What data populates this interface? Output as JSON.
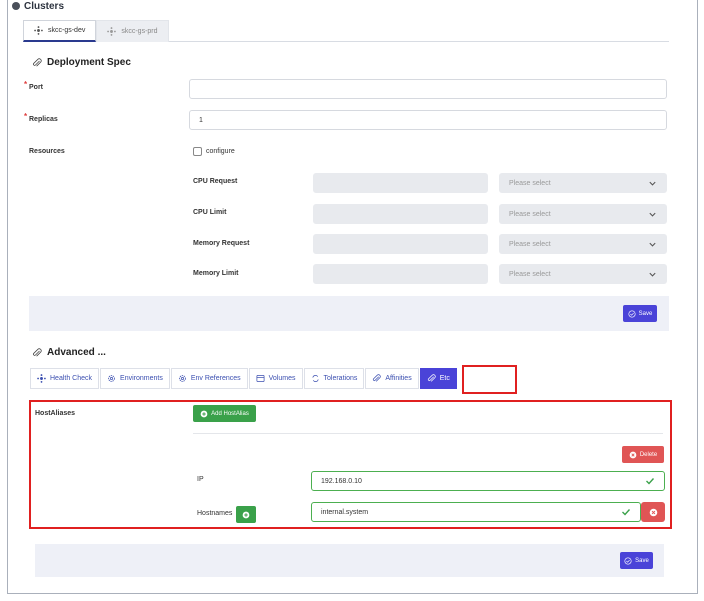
{
  "clusters": {
    "title": "Clusters",
    "tabs": [
      {
        "label": "skcc-gs-dev"
      },
      {
        "label": "skcc-gs-prd"
      }
    ]
  },
  "deployment_spec": {
    "title": "Deployment Spec",
    "port_label": "Port",
    "port_value": "",
    "replicas_label": "Replicas",
    "replicas_value": "1",
    "resources_label": "Resources",
    "configure_label": "configure",
    "rows": [
      {
        "label": "CPU Request",
        "select": "Please select"
      },
      {
        "label": "CPU Limit",
        "select": "Please select"
      },
      {
        "label": "Memory Request",
        "select": "Please select"
      },
      {
        "label": "Memory Limit",
        "select": "Please select"
      }
    ],
    "save_label": "Save"
  },
  "advanced": {
    "title": "Advanced ...",
    "tabs": [
      {
        "label": "Health Check"
      },
      {
        "label": "Environments"
      },
      {
        "label": "Env References"
      },
      {
        "label": "Volumes"
      },
      {
        "label": "Tolerations"
      },
      {
        "label": "Affinities"
      },
      {
        "label": "Etc"
      }
    ],
    "host_aliases_label": "HostAliases",
    "add_host_alias_label": "Add HostAlias",
    "delete_label": "Delete",
    "ip_label": "IP",
    "ip_value": "192.168.0.10",
    "hostnames_label": "Hostnames",
    "hostname_value": "internal.system",
    "save_label": "Save"
  },
  "colors": {
    "accent": "#4a43d8",
    "success": "#3aa14a",
    "danger": "#e05555",
    "highlight": "#e02020"
  }
}
